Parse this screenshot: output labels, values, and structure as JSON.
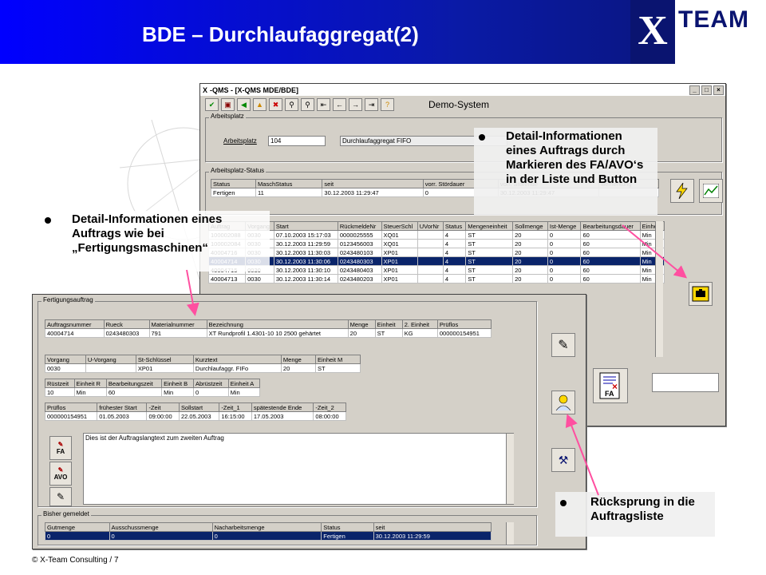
{
  "header": {
    "title": "BDE – Durchlaufaggregat(2)",
    "logo_x": "X",
    "logo_team": "TEAM"
  },
  "qms": {
    "title": "-QMS - [X-QMS MDE/BDE]",
    "system": "Demo-System",
    "wp_group": "Arbeitsplatz",
    "wp_label": "Arbeitsplatz",
    "wp_value": "104",
    "wp_name": "Durchlaufaggregat FIFO",
    "status_group": "Arbeitsplatz-Status",
    "status_cols": [
      "Status",
      "MaschStatus",
      "seit",
      "vorr. Stördauer",
      "vorr. Störende",
      "Bemerkung"
    ],
    "status_row": [
      "Fertigen",
      "11",
      "30.12.2003 11:29:47",
      "0",
      "30.12.2003 11:29:47",
      ""
    ],
    "order_cols": [
      "Auftrag",
      "Vorgang",
      "Start",
      "RückmeldeNr",
      "SteuerSchl",
      "UVorNr",
      "Status",
      "Mengeneinheit",
      "Sollmenge",
      "Ist-Menge",
      "Bearbeitungsdauer",
      "Einheit"
    ],
    "order_rows": [
      [
        "100002088",
        "0030",
        "07.10.2003 15:17:03",
        "0000025555",
        "XQ01",
        "",
        "4",
        "ST",
        "20",
        "0",
        "60",
        "Min"
      ],
      [
        "100002084",
        "0030",
        "30.12.2003 11:29:59",
        "0123456003",
        "XQ01",
        "",
        "4",
        "ST",
        "20",
        "0",
        "60",
        "Min"
      ],
      [
        "40004716",
        "0030",
        "30.12.2003 11:30:03",
        "0243480103",
        "XP01",
        "",
        "4",
        "ST",
        "20",
        "0",
        "60",
        "Min"
      ],
      [
        "40004714",
        "0030",
        "30.12.2003 11:30:06",
        "0243480303",
        "XP01",
        "",
        "4",
        "ST",
        "20",
        "0",
        "60",
        "Min"
      ],
      [
        "40004715",
        "0030",
        "30.12.2003 11:30:10",
        "0243480403",
        "XP01",
        "",
        "4",
        "ST",
        "20",
        "0",
        "60",
        "Min"
      ],
      [
        "40004713",
        "0030",
        "30.12.2003 11:30:14",
        "0243480203",
        "XP01",
        "",
        "4",
        "ST",
        "20",
        "0",
        "60",
        "Min"
      ]
    ],
    "selected_row": 3,
    "fa_label": "FA"
  },
  "detail": {
    "group1": "Fertigungsauftrag",
    "t1_cols": [
      "Auftragsnummer",
      "Rueck",
      "Materialnummer",
      "Bezeichnung",
      "Menge",
      "Einheit",
      "2. Einheit",
      "Prüflos"
    ],
    "t1_row": [
      "40004714",
      "0243480303",
      "791",
      "XT Rundprofil 1.4301-10 10 2500 gehärtet",
      "20",
      "ST",
      "KG",
      "000000154951"
    ],
    "t2_cols": [
      "Vorgang",
      "U-Vorgang",
      "St-Schlüssel",
      "Kurztext",
      "Menge",
      "Einheit M"
    ],
    "t2_row": [
      "0030",
      "",
      "XP01",
      "Durchlaufaggr. FIFo",
      "20",
      "ST"
    ],
    "t3_cols": [
      "Rüstzeit",
      "Einheit R",
      "Bearbeitungszeit",
      "Einheit B",
      "Abrüstzeit",
      "Einheit A"
    ],
    "t3_row": [
      "10",
      "Min",
      "60",
      "Min",
      "0",
      "Min"
    ],
    "t4_cols": [
      "Prüflos",
      "frühester Start",
      "-Zeit",
      "Sollstart",
      "-Zeit_1",
      "spätestende Ende",
      "-Zeit_2"
    ],
    "t4_row": [
      "000000154951",
      "01.05.2003",
      "09:00:00",
      "22.05.2003",
      "16:15:00",
      "17.05.2003",
      "08:00:00"
    ],
    "long_text": "Dies ist der Auftragslangtext zum zweiten Auftrag",
    "fa_btn": "FA",
    "avo_btn": "AVO",
    "group2": "Bisher gemeldet",
    "t5_cols": [
      "Gutmenge",
      "Ausschussmenge",
      "Nacharbeitsmenge",
      "Status",
      "seit"
    ],
    "t5_row": [
      "0",
      "0",
      "0",
      "Fertigen",
      "30.12.2003 11:29:59"
    ]
  },
  "callouts": {
    "right": "Detail-Informationen eines Auftrags durch Markieren des FA/AVO‘s in der Liste und Button",
    "left": "Detail-Informationen eines Auftrags wie bei „Fertigungsmaschinen“",
    "bottom": "Rücksprung in die Auftragsliste"
  },
  "footer": "© X-Team Consulting / 7",
  "colors": {
    "accent": "#0000ff",
    "arrow": "#ff4fa0",
    "selection": "#0a246a"
  }
}
